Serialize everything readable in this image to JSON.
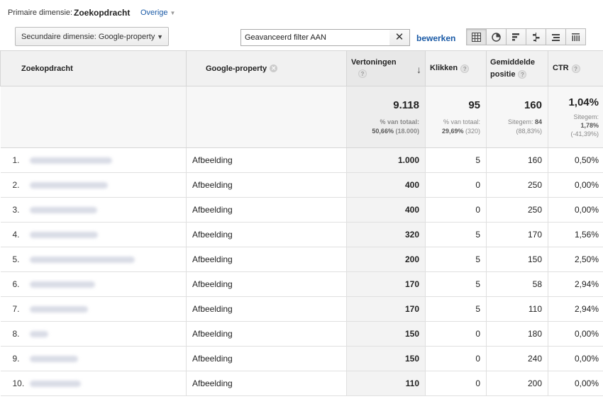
{
  "top": {
    "primary_label": "Primaire dimensie:",
    "primary_value": "Zoekopdracht",
    "other_label": "Overige"
  },
  "toolbar": {
    "secondary_label": "Secundaire dimensie: Google-property",
    "filter_text": "Geavanceerd filter AAN",
    "edit_label": "bewerken"
  },
  "columns": {
    "query": "Zoekopdracht",
    "property": "Google-property",
    "impressions": "Vertoningen",
    "clicks": "Klikken",
    "position_1": "Gemiddelde",
    "position_2": "positie",
    "ctr": "CTR"
  },
  "totals": {
    "impressions": "9.118",
    "impressions_sub1": "% van totaal:",
    "impressions_sub2": "50,66%",
    "impressions_sub3": "(18.000)",
    "clicks": "95",
    "clicks_sub1": "% van totaal:",
    "clicks_sub2": "29,69%",
    "clicks_sub3": "(320)",
    "position": "160",
    "position_sub1": "Sitegem:",
    "position_sub2": "84",
    "position_sub3": "(88,83%)",
    "ctr": "1,04%",
    "ctr_sub1": "Sitegem:",
    "ctr_sub2": "1,78%",
    "ctr_sub3": "(-41,39%)"
  },
  "rows": [
    {
      "index": "1.",
      "property": "Afbeelding",
      "impressions": "1.000",
      "clicks": "5",
      "position": "160",
      "ctr": "0,50%"
    },
    {
      "index": "2.",
      "property": "Afbeelding",
      "impressions": "400",
      "clicks": "0",
      "position": "250",
      "ctr": "0,00%"
    },
    {
      "index": "3.",
      "property": "Afbeelding",
      "impressions": "400",
      "clicks": "0",
      "position": "250",
      "ctr": "0,00%"
    },
    {
      "index": "4.",
      "property": "Afbeelding",
      "impressions": "320",
      "clicks": "5",
      "position": "170",
      "ctr": "1,56%"
    },
    {
      "index": "5.",
      "property": "Afbeelding",
      "impressions": "200",
      "clicks": "5",
      "position": "150",
      "ctr": "2,50%"
    },
    {
      "index": "6.",
      "property": "Afbeelding",
      "impressions": "170",
      "clicks": "5",
      "position": "58",
      "ctr": "2,94%"
    },
    {
      "index": "7.",
      "property": "Afbeelding",
      "impressions": "170",
      "clicks": "5",
      "position": "110",
      "ctr": "2,94%"
    },
    {
      "index": "8.",
      "property": "Afbeelding",
      "impressions": "150",
      "clicks": "0",
      "position": "180",
      "ctr": "0,00%"
    },
    {
      "index": "9.",
      "property": "Afbeelding",
      "impressions": "150",
      "clicks": "0",
      "position": "240",
      "ctr": "0,00%"
    },
    {
      "index": "10.",
      "property": "Afbeelding",
      "impressions": "110",
      "clicks": "0",
      "position": "200",
      "ctr": "0,00%"
    }
  ],
  "icons": {
    "views": [
      "table-view-icon",
      "pie-view-icon",
      "bar-view-icon",
      "comparison-view-icon",
      "pivot-view-icon",
      "term-cloud-icon"
    ],
    "sort": "sort-desc-arrow-icon",
    "help": "help-icon"
  },
  "colors": {
    "link": "#1a5aa6",
    "header_bg": "#f1f1f1"
  }
}
